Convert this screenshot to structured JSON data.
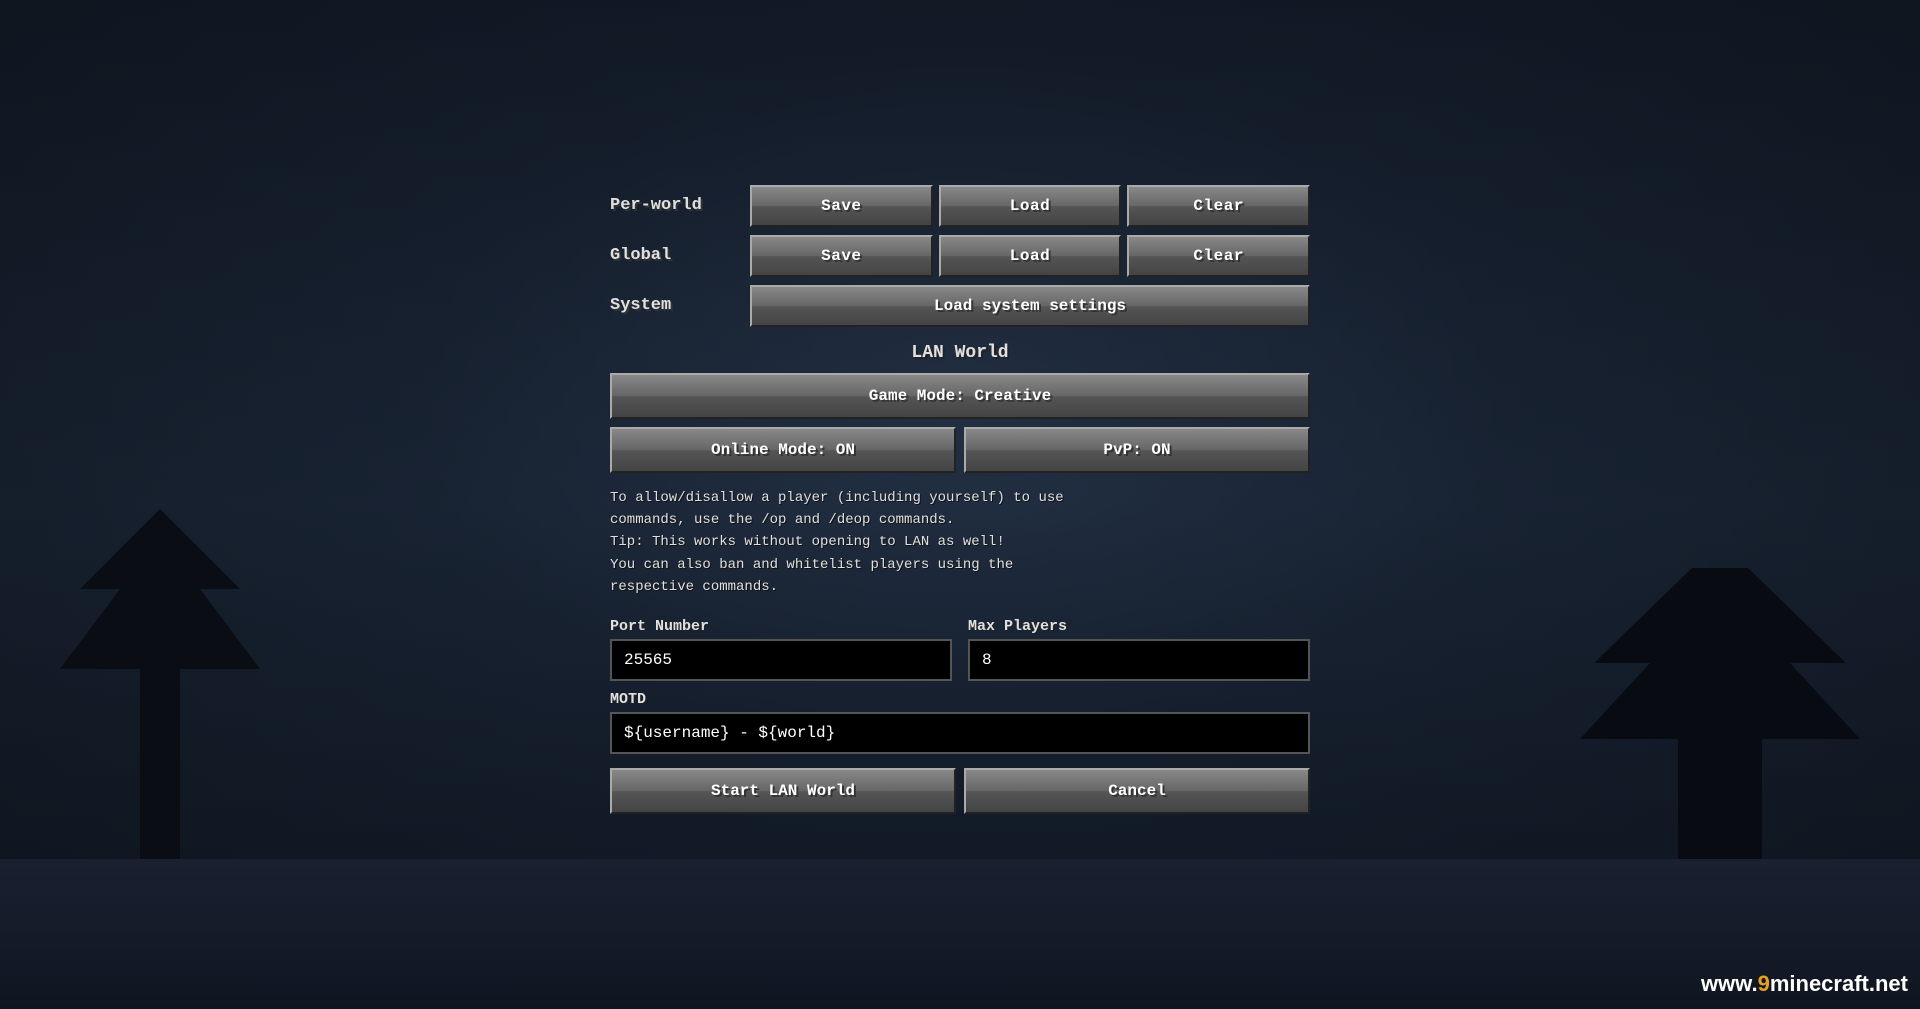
{
  "background": {
    "color": "#1a2030"
  },
  "settings": {
    "per_world": {
      "label": "Per-world",
      "save_label": "Save",
      "load_label": "Load",
      "clear_label": "Clear"
    },
    "global": {
      "label": "Global",
      "save_label": "Save",
      "load_label": "Load",
      "clear_label": "Clear"
    },
    "system": {
      "label": "System",
      "load_system_label": "Load system settings"
    }
  },
  "lan_world": {
    "title": "LAN World",
    "game_mode_label": "Game Mode: Creative",
    "online_mode_label": "Online Mode: ON",
    "pvp_label": "PvP: ON",
    "info_text": "To allow/disallow a player (including yourself) to use\ncommands, use the /op and /deop commands.\nTip: This works without opening to LAN as well!\nYou can also ban and whitelist players using the\nrespective commands.",
    "port_number_label": "Port Number",
    "port_number_value": "25565",
    "max_players_label": "Max Players",
    "max_players_value": "8",
    "motd_label": "MOTD",
    "motd_value": "${username} - ${world}",
    "start_label": "Start LAN World",
    "cancel_label": "Cancel"
  },
  "watermark": {
    "text": "www.9minecraft.net",
    "www_part": "www.",
    "nine_part": "9",
    "mine_part": "minecraft",
    "net_part": ".net"
  }
}
